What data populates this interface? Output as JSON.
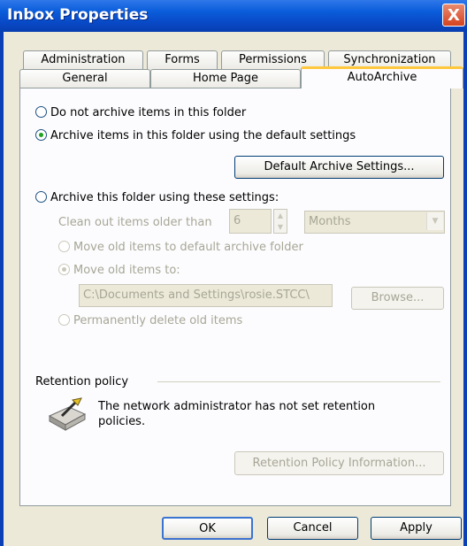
{
  "window": {
    "title": "Inbox Properties",
    "close_label": "X"
  },
  "tabs": {
    "row1": [
      {
        "label": "Administration"
      },
      {
        "label": "Forms"
      },
      {
        "label": "Permissions"
      },
      {
        "label": "Synchronization"
      }
    ],
    "row2": [
      {
        "label": "General"
      },
      {
        "label": "Home Page"
      },
      {
        "label": "AutoArchive",
        "active": true
      }
    ]
  },
  "archive": {
    "option_none": "Do not archive items in this folder",
    "option_default": "Archive items in this folder using the default settings",
    "default_settings_button": "Default Archive Settings...",
    "option_custom": "Archive this folder using these settings:",
    "clean_label": "Clean out items older than",
    "age_value": "6",
    "age_unit": "Months",
    "move_default": "Move old items to default archive folder",
    "move_to": "Move old items to:",
    "path_value": "C:\\Documents and Settings\\rosie.STCC\\",
    "browse_button": "Browse...",
    "delete_option": "Permanently delete old items",
    "selected": "option_default"
  },
  "retention": {
    "heading": "Retention policy",
    "message": "The network administrator has not set retention policies.",
    "info_button": "Retention Policy Information..."
  },
  "footer": {
    "ok": "OK",
    "cancel": "Cancel",
    "apply": "Apply"
  }
}
